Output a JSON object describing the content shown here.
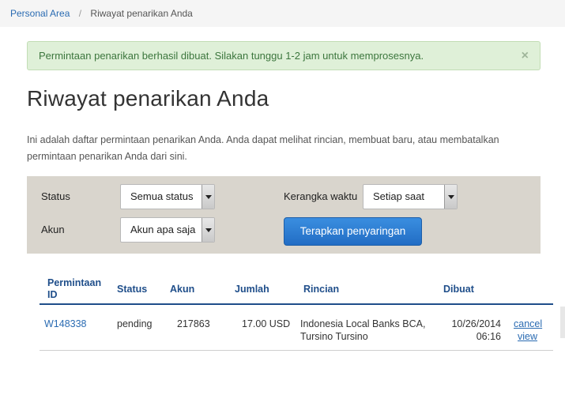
{
  "breadcrumb": {
    "home": "Personal Area",
    "separator": "/",
    "current": "Riwayat penarikan Anda"
  },
  "alert": {
    "message": "Permintaan penarikan berhasil dibuat. Silakan tunggu 1-2 jam untuk memprosesnya.",
    "close_label": "×"
  },
  "page": {
    "title": "Riwayat penarikan Anda",
    "intro": "Ini adalah daftar permintaan penarikan Anda. Anda dapat melihat rincian, membuat baru, atau membatalkan permintaan penarikan Anda dari sini."
  },
  "filters": {
    "status_label": "Status",
    "status_value": "Semua status",
    "account_label": "Akun",
    "account_value": "Akun apa saja",
    "timeframe_label": "Kerangka waktu",
    "timeframe_value": "Setiap saat",
    "apply_label": "Terapkan penyaringan"
  },
  "table": {
    "headers": {
      "request_id": "Permintaan ID",
      "status": "Status",
      "account": "Akun",
      "amount": "Jumlah",
      "details": "Rincian",
      "created": "Dibuat"
    },
    "rows": [
      {
        "request_id": "W148338",
        "status": "pending",
        "account": "217863",
        "amount": "17.00 USD",
        "details": "Indonesia Local Banks BCA, Tursino Tursino",
        "created_date": "10/26/2014",
        "created_time": "06:16",
        "cancel_label": "cancel",
        "view_label": "view"
      }
    ]
  },
  "colors": {
    "link": "#2a6bb2",
    "header_text": "#1f4e8a",
    "alert_bg": "#dff0d8",
    "alert_text": "#3c763d",
    "filter_bg": "#d9d5cd",
    "button_bg": "#2a7bd2"
  }
}
